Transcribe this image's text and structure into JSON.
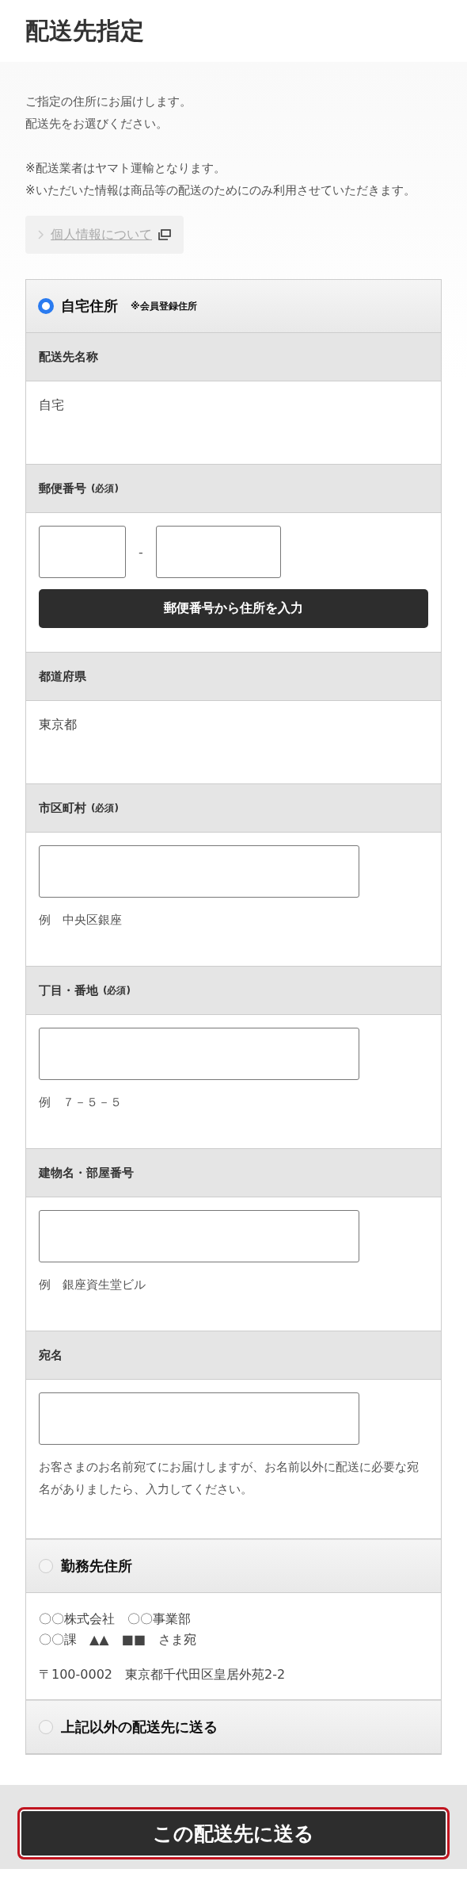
{
  "title": "配送先指定",
  "intro": [
    "ご指定の住所にお届けします。",
    "配送先をお選びください。"
  ],
  "notes": [
    "※配送業者はヤマト運輸となります。",
    "※いただいた情報は商品等の配送のためにのみ利用させていただきます。"
  ],
  "privacy_link": {
    "label": "個人情報について"
  },
  "options": [
    {
      "label": "自宅住所",
      "note": "※会員登録住所",
      "selected": true,
      "fields": [
        {
          "kind": "text",
          "label": "配送先名称",
          "value": "自宅"
        },
        {
          "kind": "postal",
          "label": "郵便番号",
          "required": "(必須)",
          "separator": "-",
          "button": "郵便番号から住所を入力"
        },
        {
          "kind": "text",
          "label": "都道府県",
          "value": "東京都"
        },
        {
          "kind": "input",
          "label": "市区町村",
          "required": "(必須)",
          "hint": "例　中央区銀座"
        },
        {
          "kind": "input",
          "label": "丁目・番地",
          "required": "(必須)",
          "hint": "例　７－５－５"
        },
        {
          "kind": "input",
          "label": "建物名・部屋番号",
          "hint": "例　銀座資生堂ビル"
        },
        {
          "kind": "input",
          "label": "宛名",
          "hint": "お客さまのお名前宛てにお届けしますが、お名前以外に配送に必要な宛名がありましたら、入力してください。"
        }
      ]
    },
    {
      "label": "勤務先住所",
      "selected": false,
      "address": [
        "〇〇株式会社　〇〇事業部",
        "〇〇課　▲▲　■■　さま宛"
      ],
      "postal_address": "〒100-0002　東京都千代田区皇居外苑2-2"
    },
    {
      "label": "上記以外の配送先に送る",
      "selected": false
    }
  ],
  "submit": "この配送先に送る"
}
